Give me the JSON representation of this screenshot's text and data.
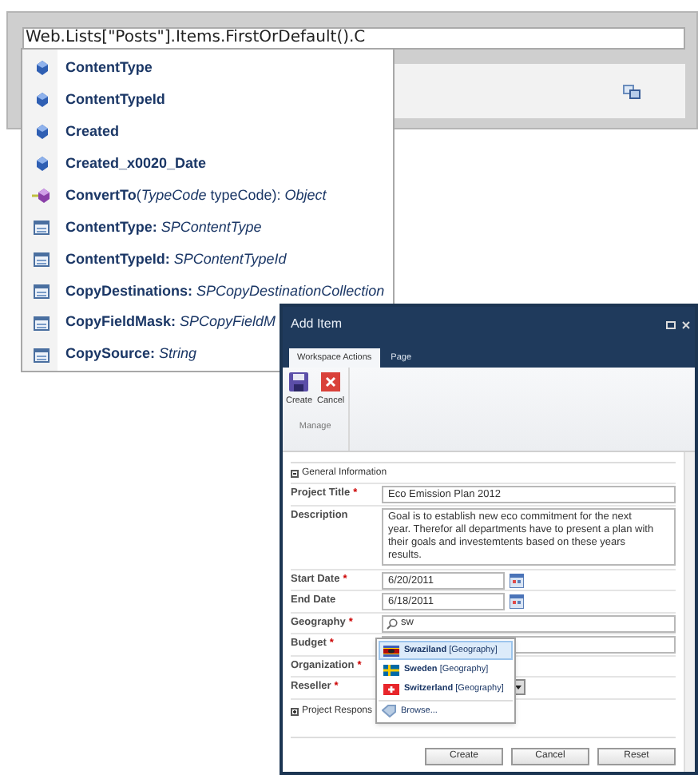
{
  "editor": {
    "code": "Web.Lists[\"Posts\"].Items.FirstOrDefault().C"
  },
  "completion_list": [
    {
      "kind": "field",
      "text": "ContentType"
    },
    {
      "kind": "field",
      "text": "ContentTypeId"
    },
    {
      "kind": "field",
      "text": "Created"
    },
    {
      "kind": "field",
      "text": "Created_x0020_Date"
    },
    {
      "kind": "method",
      "text": "**ConvertTo**(*TypeCode* typeCode): *Object*"
    },
    {
      "kind": "property",
      "text": "**ContentType:** *SPContentType*"
    },
    {
      "kind": "property",
      "text": "**ContentTypeId:** *SPContentTypeId*"
    },
    {
      "kind": "property",
      "text": "**CopyDestinations:** *SPCopyDestinationCollection*"
    },
    {
      "kind": "property",
      "text": "**CopyFieldMask:** *SPCopyFieldM*"
    },
    {
      "kind": "property",
      "text": "**CopySource:** *String*"
    }
  ],
  "dialog": {
    "title": "Add Item",
    "tabs": [
      {
        "label": "Workspace Actions",
        "selected": true
      },
      {
        "label": "Page",
        "selected": false
      }
    ],
    "ribbon": {
      "buttons": [
        {
          "kind": "save",
          "label": "Create"
        },
        {
          "kind": "cancel",
          "label": "Cancel"
        }
      ],
      "group": "Manage"
    },
    "first_section": {
      "title": "General Information",
      "expanded": true
    },
    "fields": [
      {
        "label": "Project Title",
        "required_mark": "*",
        "kind": "text",
        "value": "Eco Emission Plan 2012"
      },
      {
        "label": "Description",
        "kind": "textarea",
        "value": "Goal is to establish new eco commitment for the next year. Therefor all departments have to present a plan with their goals and investemtents based on these years results."
      },
      {
        "label": "Start Date",
        "required_mark": "*",
        "kind": "date",
        "value": "6/20/2011"
      },
      {
        "label": "End Date",
        "kind": "date",
        "value": "6/18/2011"
      },
      {
        "label": "Geography",
        "required_mark": "*",
        "kind": "search",
        "value": "sw"
      },
      {
        "label": "Budget",
        "required_mark": "*",
        "kind": "text"
      },
      {
        "label": "Organization",
        "required_mark": "*",
        "kind": "hidden"
      },
      {
        "label": "Reseller",
        "required_mark": "*",
        "kind": "select"
      }
    ],
    "second_section": {
      "title": "Project Respons",
      "expanded": false
    },
    "suggestions": [
      {
        "kind": "swaziland",
        "name": "Swaziland",
        "type": "[Geography]",
        "selected": true
      },
      {
        "kind": "sweden",
        "name": "Sweden",
        "type": "[Geography]",
        "selected": false
      },
      {
        "kind": "switzerland",
        "name": "Switzerland",
        "type": "[Geography]",
        "selected": false
      }
    ],
    "browse": "Browse...",
    "buttons": [
      "Create",
      "Cancel",
      "Reset"
    ]
  }
}
